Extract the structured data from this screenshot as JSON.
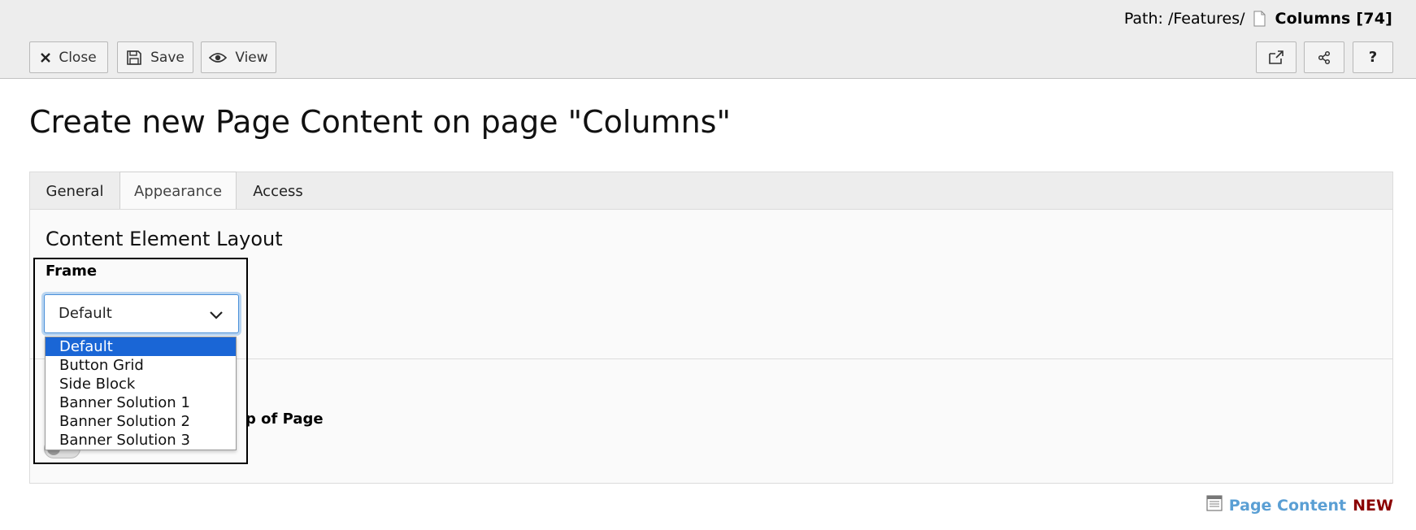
{
  "header": {
    "path_label": "Path: /Features/",
    "record_title": "Columns [74]",
    "buttons": {
      "close": "Close",
      "save": "Save",
      "view": "View"
    },
    "icon_buttons": [
      "open-new-window-icon",
      "share-icon",
      "help-icon"
    ],
    "help_glyph": "?"
  },
  "page": {
    "title": "Create new Page Content on page \"Columns\""
  },
  "tabs": [
    {
      "label": "General",
      "active": false
    },
    {
      "label": "Appearance",
      "active": true
    },
    {
      "label": "Access",
      "active": false
    }
  ],
  "panel": {
    "section_title": "Content Element Layout",
    "frame": {
      "label": "Frame",
      "selected": "Default",
      "options": [
        "Default",
        "Button Grid",
        "Side Block",
        "Banner Solution 1",
        "Banner Solution 2",
        "Banner Solution 3"
      ]
    },
    "partially_hidden_label": "p of Page"
  },
  "footer": {
    "type_label": "Page Content",
    "status_label": "NEW"
  },
  "colors": {
    "accent": "#1a66d6",
    "type_label": "#5a9fd4",
    "status_label": "#8b0000"
  }
}
